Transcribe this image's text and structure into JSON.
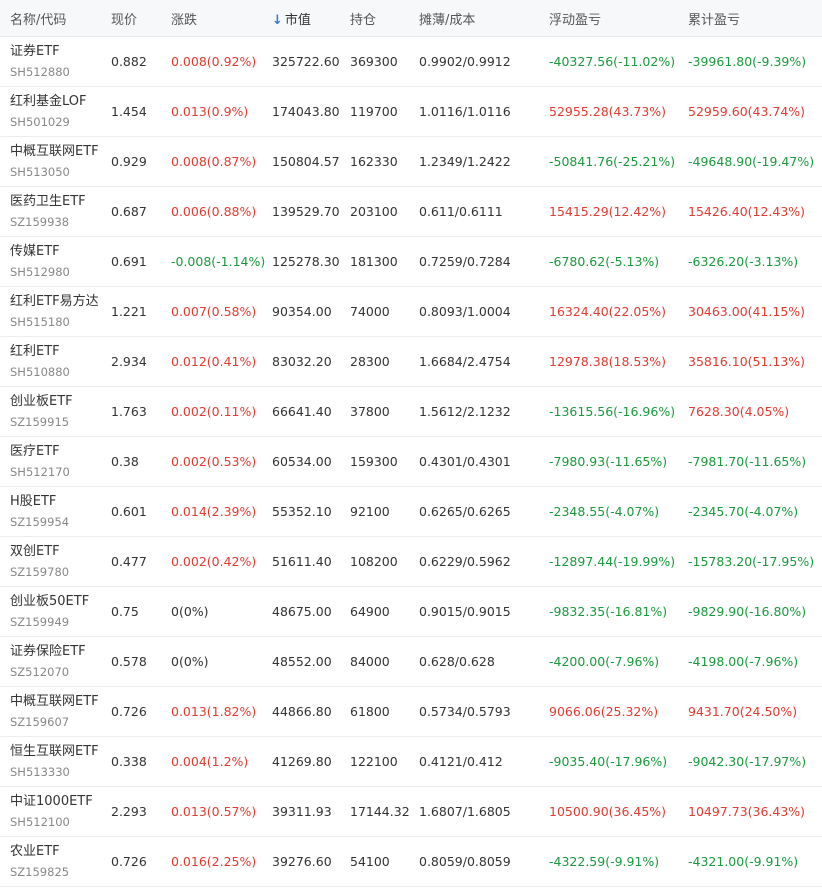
{
  "header": {
    "name": "名称/代码",
    "price": "现价",
    "change": "涨跌",
    "sort_arrow": "↓",
    "value": "市值",
    "hold": "持仓",
    "cost": "摊薄/成本",
    "float_pnl": "浮动盈亏",
    "total_pnl": "累计盈亏"
  },
  "colors": {
    "up": "#e03c31",
    "down": "#1a9a3c",
    "sort": "#2a7ae2"
  },
  "rows": [
    {
      "name": "证券ETF",
      "code": "SH512880",
      "price": "0.882",
      "change": "0.008(0.92%)",
      "change_dir": "up",
      "value": "325722.60",
      "hold": "369300",
      "cost": "0.9902/0.9912",
      "float": "-40327.56(-11.02%)",
      "float_dir": "down",
      "total": "-39961.80(-9.39%)",
      "total_dir": "down"
    },
    {
      "name": "红利基金LOF",
      "code": "SH501029",
      "price": "1.454",
      "change": "0.013(0.9%)",
      "change_dir": "up",
      "value": "174043.80",
      "hold": "119700",
      "cost": "1.0116/1.0116",
      "float": "52955.28(43.73%)",
      "float_dir": "up",
      "total": "52959.60(43.74%)",
      "total_dir": "up"
    },
    {
      "name": "中概互联网ETF",
      "code": "SH513050",
      "price": "0.929",
      "change": "0.008(0.87%)",
      "change_dir": "up",
      "value": "150804.57",
      "hold": "162330",
      "cost": "1.2349/1.2422",
      "float": "-50841.76(-25.21%)",
      "float_dir": "down",
      "total": "-49648.90(-19.47%)",
      "total_dir": "down"
    },
    {
      "name": "医药卫生ETF",
      "code": "SZ159938",
      "price": "0.687",
      "change": "0.006(0.88%)",
      "change_dir": "up",
      "value": "139529.70",
      "hold": "203100",
      "cost": "0.611/0.6111",
      "float": "15415.29(12.42%)",
      "float_dir": "up",
      "total": "15426.40(12.43%)",
      "total_dir": "up"
    },
    {
      "name": "传媒ETF",
      "code": "SH512980",
      "price": "0.691",
      "change": "-0.008(-1.14%)",
      "change_dir": "down",
      "value": "125278.30",
      "hold": "181300",
      "cost": "0.7259/0.7284",
      "float": "-6780.62(-5.13%)",
      "float_dir": "down",
      "total": "-6326.20(-3.13%)",
      "total_dir": "down"
    },
    {
      "name": "红利ETF易方达",
      "code": "SH515180",
      "price": "1.221",
      "change": "0.007(0.58%)",
      "change_dir": "up",
      "value": "90354.00",
      "hold": "74000",
      "cost": "0.8093/1.0004",
      "float": "16324.40(22.05%)",
      "float_dir": "up",
      "total": "30463.00(41.15%)",
      "total_dir": "up"
    },
    {
      "name": "红利ETF",
      "code": "SH510880",
      "price": "2.934",
      "change": "0.012(0.41%)",
      "change_dir": "up",
      "value": "83032.20",
      "hold": "28300",
      "cost": "1.6684/2.4754",
      "float": "12978.38(18.53%)",
      "float_dir": "up",
      "total": "35816.10(51.13%)",
      "total_dir": "up"
    },
    {
      "name": "创业板ETF",
      "code": "SZ159915",
      "price": "1.763",
      "change": "0.002(0.11%)",
      "change_dir": "up",
      "value": "66641.40",
      "hold": "37800",
      "cost": "1.5612/2.1232",
      "float": "-13615.56(-16.96%)",
      "float_dir": "down",
      "total": "7628.30(4.05%)",
      "total_dir": "up"
    },
    {
      "name": "医疗ETF",
      "code": "SH512170",
      "price": "0.38",
      "change": "0.002(0.53%)",
      "change_dir": "up",
      "value": "60534.00",
      "hold": "159300",
      "cost": "0.4301/0.4301",
      "float": "-7980.93(-11.65%)",
      "float_dir": "down",
      "total": "-7981.70(-11.65%)",
      "total_dir": "down"
    },
    {
      "name": "H股ETF",
      "code": "SZ159954",
      "price": "0.601",
      "change": "0.014(2.39%)",
      "change_dir": "up",
      "value": "55352.10",
      "hold": "92100",
      "cost": "0.6265/0.6265",
      "float": "-2348.55(-4.07%)",
      "float_dir": "down",
      "total": "-2345.70(-4.07%)",
      "total_dir": "down"
    },
    {
      "name": "双创ETF",
      "code": "SZ159780",
      "price": "0.477",
      "change": "0.002(0.42%)",
      "change_dir": "up",
      "value": "51611.40",
      "hold": "108200",
      "cost": "0.6229/0.5962",
      "float": "-12897.44(-19.99%)",
      "float_dir": "down",
      "total": "-15783.20(-17.95%)",
      "total_dir": "down"
    },
    {
      "name": "创业板50ETF",
      "code": "SZ159949",
      "price": "0.75",
      "change": "0(0%)",
      "change_dir": "flat",
      "value": "48675.00",
      "hold": "64900",
      "cost": "0.9015/0.9015",
      "float": "-9832.35(-16.81%)",
      "float_dir": "down",
      "total": "-9829.90(-16.80%)",
      "total_dir": "down"
    },
    {
      "name": "证券保险ETF",
      "code": "SZ512070",
      "price": "0.578",
      "change": "0(0%)",
      "change_dir": "flat",
      "value": "48552.00",
      "hold": "84000",
      "cost": "0.628/0.628",
      "float": "-4200.00(-7.96%)",
      "float_dir": "down",
      "total": "-4198.00(-7.96%)",
      "total_dir": "down"
    },
    {
      "name": "中概互联网ETF",
      "code": "SZ159607",
      "price": "0.726",
      "change": "0.013(1.82%)",
      "change_dir": "up",
      "value": "44866.80",
      "hold": "61800",
      "cost": "0.5734/0.5793",
      "float": "9066.06(25.32%)",
      "float_dir": "up",
      "total": "9431.70(24.50%)",
      "total_dir": "up"
    },
    {
      "name": "恒生互联网ETF",
      "code": "SH513330",
      "price": "0.338",
      "change": "0.004(1.2%)",
      "change_dir": "up",
      "value": "41269.80",
      "hold": "122100",
      "cost": "0.4121/0.412",
      "float": "-9035.40(-17.96%)",
      "float_dir": "down",
      "total": "-9042.30(-17.97%)",
      "total_dir": "down"
    },
    {
      "name": "中证1000ETF",
      "code": "SH512100",
      "price": "2.293",
      "change": "0.013(0.57%)",
      "change_dir": "up",
      "value": "39311.93",
      "hold": "17144.32",
      "cost": "1.6807/1.6805",
      "float": "10500.90(36.45%)",
      "float_dir": "up",
      "total": "10497.73(36.43%)",
      "total_dir": "up"
    },
    {
      "name": "农业ETF",
      "code": "SZ159825",
      "price": "0.726",
      "change": "0.016(2.25%)",
      "change_dir": "up",
      "value": "39276.60",
      "hold": "54100",
      "cost": "0.8059/0.8059",
      "float": "-4322.59(-9.91%)",
      "float_dir": "down",
      "total": "-4321.00(-9.91%)",
      "total_dir": "down"
    }
  ]
}
